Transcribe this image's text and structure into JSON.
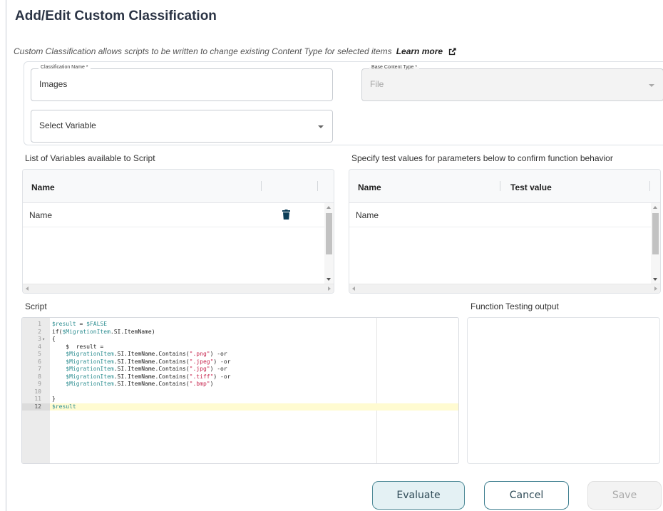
{
  "dialog": {
    "title": "Add/Edit Custom Classification",
    "description": "Custom Classification allows scripts to be written to change existing Content Type for selected items",
    "learn_more": "Learn more"
  },
  "form": {
    "classification_name": {
      "label": "Classification Name *",
      "value": "Images"
    },
    "base_content_type": {
      "label": "Base Content Type *",
      "value": "File",
      "disabled": true
    },
    "select_variable": {
      "placeholder": "Select Variable"
    }
  },
  "variables_panel": {
    "label": "List of Variables available to Script",
    "columns": [
      "Name"
    ],
    "rows": [
      {
        "name": "Name"
      }
    ]
  },
  "test_values_panel": {
    "label": "Specify test values for parameters below to confirm function behavior",
    "columns": [
      "Name",
      "Test value"
    ],
    "rows": [
      {
        "name": "Name",
        "test_value": ""
      }
    ]
  },
  "script": {
    "label": "Script",
    "active_line": 12,
    "lines": [
      "$result = $FALSE",
      "if($MigrationItem.SI.ItemName)",
      "{",
      "    $  result =",
      "    $MigrationItem.SI.ItemName.Contains(\".png\") -or",
      "    $MigrationItem.SI.ItemName.Contains(\".jpeg\") -or",
      "    $MigrationItem.SI.ItemName.Contains(\".jpg\") -or",
      "    $MigrationItem.SI.ItemName.Contains(\".tiff\") -or",
      "    $MigrationItem.SI.ItemName.Contains(\".bmp\")",
      "",
      "}",
      "$result"
    ]
  },
  "output_panel": {
    "label": "Function Testing output"
  },
  "buttons": {
    "evaluate": "Evaluate",
    "cancel": "Cancel",
    "save": "Save"
  },
  "colors": {
    "primary_border": "#3f7f90",
    "evaluate_bg": "#e4f1f4",
    "trash_icon": "#0b3d57",
    "active_line_bg": "#fffbd1",
    "code_variable": "#2f8f92",
    "code_string": "#c7254e"
  },
  "icons": {
    "external_link": "external-link-icon",
    "trash": "trash-icon",
    "dropdown": "chevron-down-icon"
  }
}
